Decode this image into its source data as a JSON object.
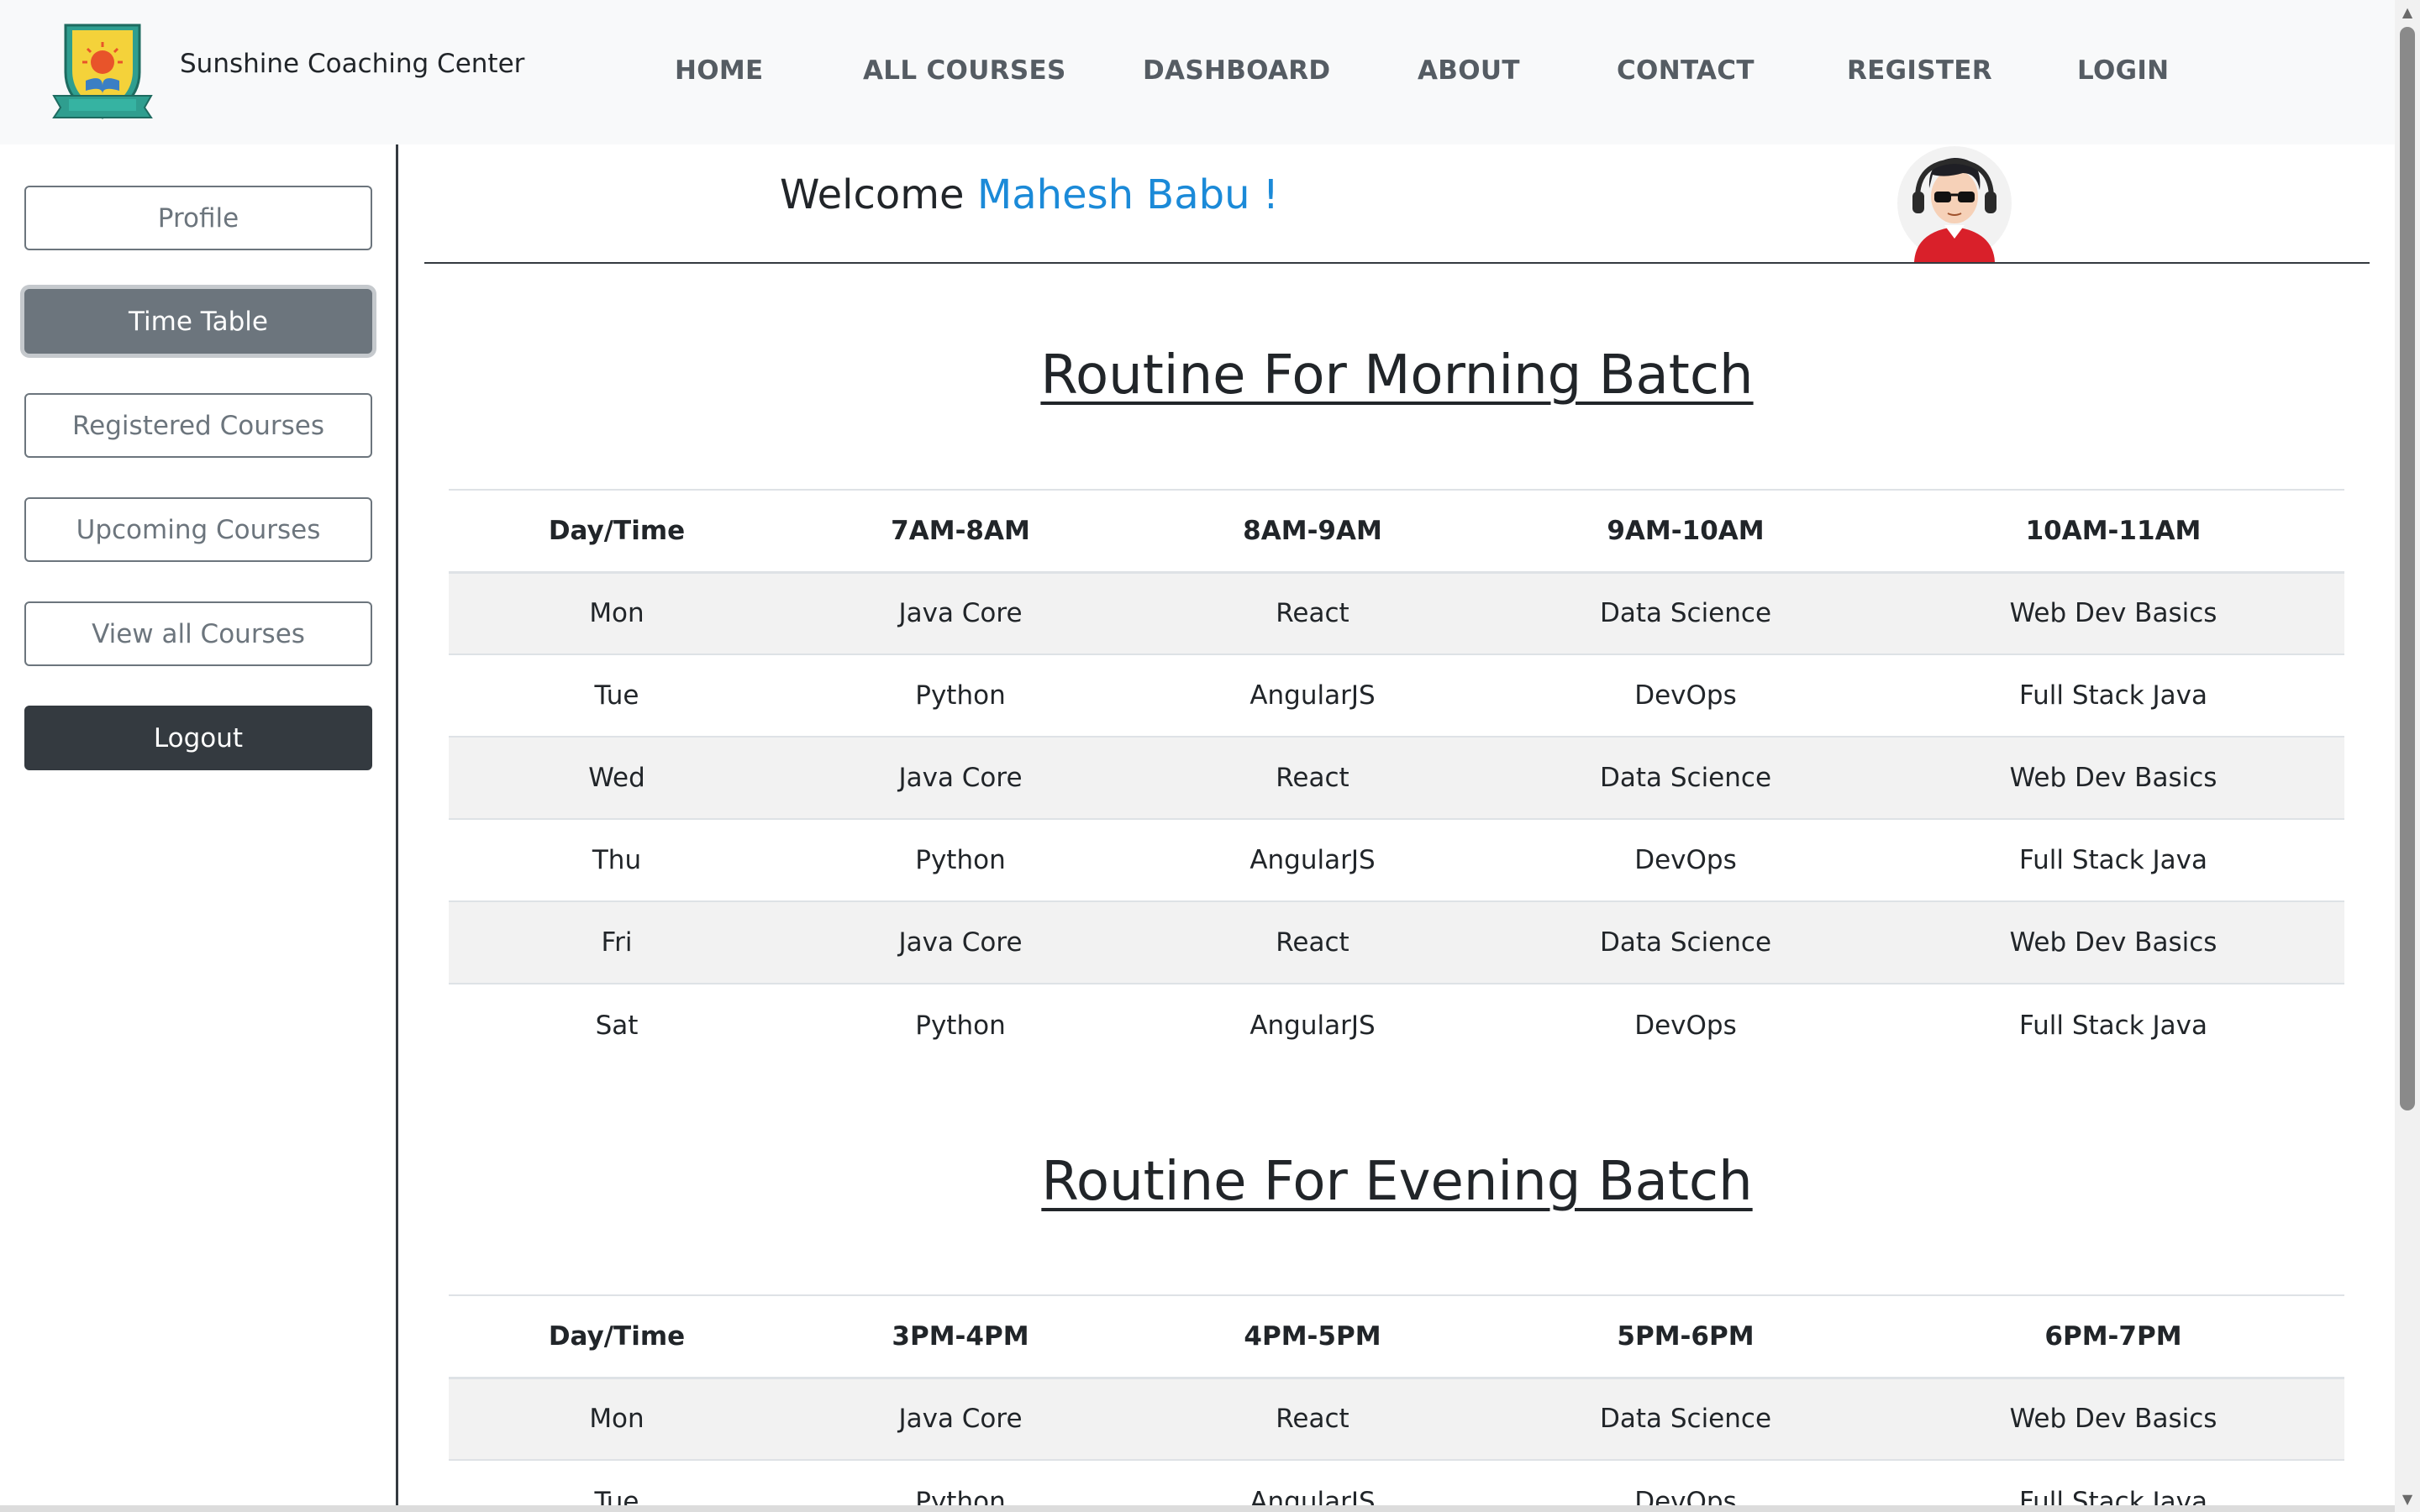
{
  "brand": {
    "name": "Sunshine Coaching Center",
    "logo_icon": "school-crest-logo"
  },
  "nav": {
    "items": [
      {
        "label": "HOME"
      },
      {
        "label": "ALL COURSES"
      },
      {
        "label": "DASHBOARD"
      },
      {
        "label": "ABOUT"
      },
      {
        "label": "CONTACT"
      },
      {
        "label": "REGISTER"
      },
      {
        "label": "LOGIN"
      }
    ]
  },
  "sidebar": {
    "items": [
      {
        "label": "Profile",
        "state": "default"
      },
      {
        "label": "Time Table",
        "state": "active"
      },
      {
        "label": "Registered Courses",
        "state": "default"
      },
      {
        "label": "Upcoming Courses",
        "state": "default"
      },
      {
        "label": "View all Courses",
        "state": "default"
      },
      {
        "label": "Logout",
        "state": "dark"
      }
    ]
  },
  "welcome": {
    "prefix": "Welcome",
    "name": "Mahesh Babu !",
    "avatar_icon": "user-avatar-with-sunglasses"
  },
  "morning": {
    "title": "Routine For Morning Batch",
    "headers": [
      "Day/Time",
      "7AM-8AM",
      "8AM-9AM",
      "9AM-10AM",
      "10AM-11AM"
    ],
    "rows": [
      [
        "Mon",
        "Java Core",
        "React",
        "Data Science",
        "Web Dev Basics"
      ],
      [
        "Tue",
        "Python",
        "AngularJS",
        "DevOps",
        "Full Stack Java"
      ],
      [
        "Wed",
        "Java Core",
        "React",
        "Data Science",
        "Web Dev Basics"
      ],
      [
        "Thu",
        "Python",
        "AngularJS",
        "DevOps",
        "Full Stack Java"
      ],
      [
        "Fri",
        "Java Core",
        "React",
        "Data Science",
        "Web Dev Basics"
      ],
      [
        "Sat",
        "Python",
        "AngularJS",
        "DevOps",
        "Full Stack Java"
      ]
    ]
  },
  "evening": {
    "title": "Routine For Evening Batch",
    "headers": [
      "Day/Time",
      "3PM-4PM",
      "4PM-5PM",
      "5PM-6PM",
      "6PM-7PM"
    ],
    "rows": [
      [
        "Mon",
        "Java Core",
        "React",
        "Data Science",
        "Web Dev Basics"
      ],
      [
        "Tue",
        "Python",
        "AngularJS",
        "DevOps",
        "Full Stack Java"
      ]
    ]
  },
  "colors": {
    "accent_name": "#1b8ad8",
    "active_button": "#6c757d",
    "logout_button": "#343a40",
    "navbar_bg": "#f8f9fa"
  }
}
